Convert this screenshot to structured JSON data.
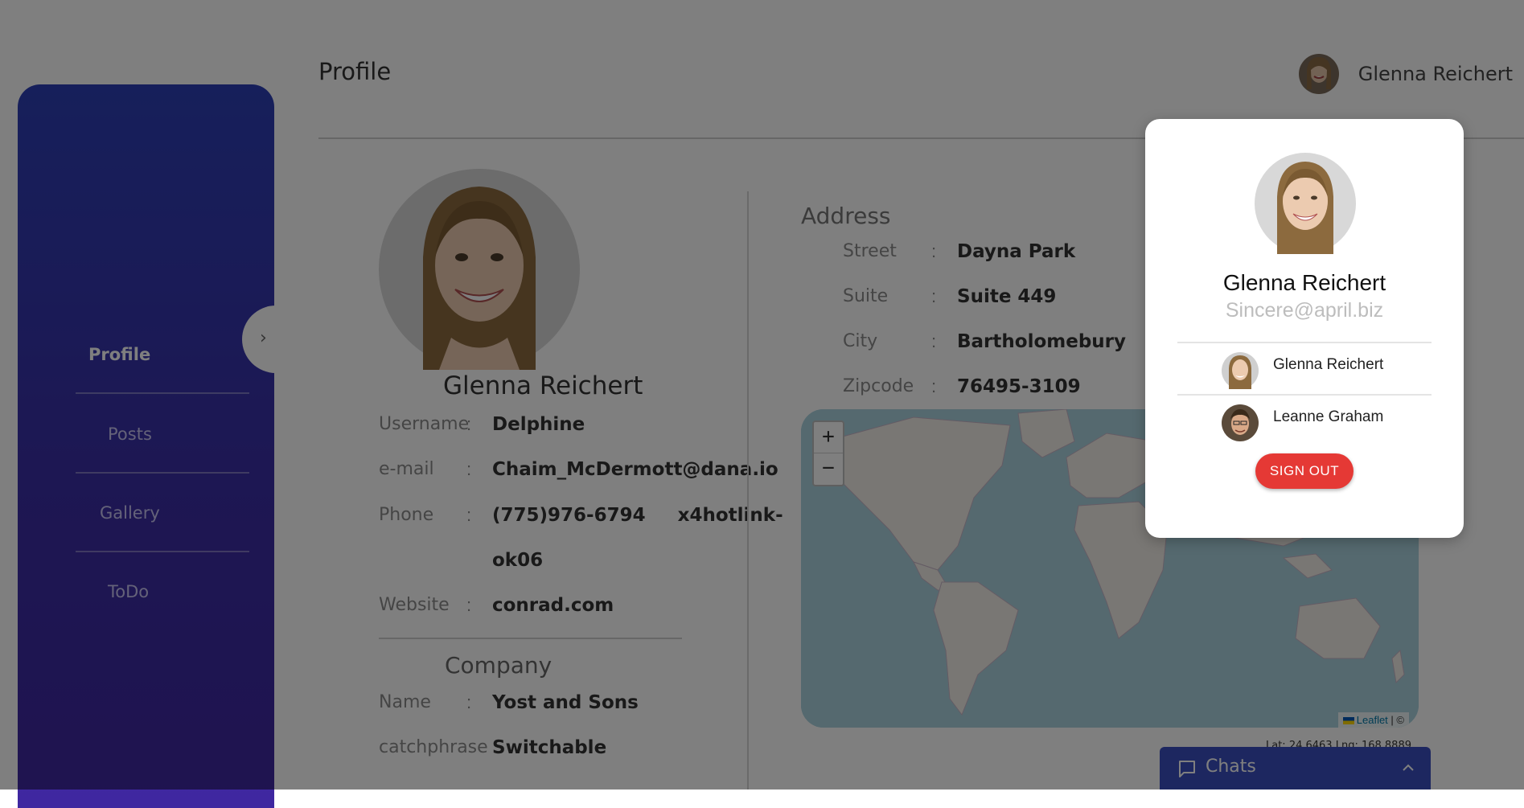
{
  "sidebar": {
    "items": [
      {
        "label": "Profile",
        "active": true
      },
      {
        "label": "Posts",
        "active": false
      },
      {
        "label": "Gallery",
        "active": false
      },
      {
        "label": "ToDo",
        "active": false
      }
    ],
    "toggle_icon": "chevron-right-icon",
    "gradient": [
      "#2d3fb6",
      "#3f27a0"
    ]
  },
  "header": {
    "title": "Profile",
    "user_name": "Glenna Reichert"
  },
  "profile": {
    "name": "Glenna Reichert",
    "fields": [
      {
        "label": "Username",
        "value": "Delphine"
      },
      {
        "label": "e-mail",
        "value": "Chaim_McDermott@dana.io"
      },
      {
        "label": "Phone",
        "value_line1": "(775)976-6794     x4hotlink-",
        "value_line2": "ok06"
      },
      {
        "label": "Website",
        "value": "conrad.com"
      }
    ],
    "company_title": "Company",
    "company_fields": [
      {
        "label": "Name",
        "value": "Yost and Sons"
      },
      {
        "label": "catchphrase",
        "value": "Switchable"
      }
    ]
  },
  "address": {
    "title": "Address",
    "fields": [
      {
        "label": "Street",
        "value": "Dayna Park"
      },
      {
        "label": "Suite",
        "value": "Suite 449"
      },
      {
        "label": "City",
        "value": "Bartholomebury"
      },
      {
        "label": "Zipcode",
        "value": "76495-3109"
      }
    ]
  },
  "map": {
    "zoom_in": "+",
    "zoom_out": "−",
    "attribution_link": "Leaflet",
    "attribution_rest": " | ©",
    "coords_text": "Lat: 24.6463   Lng: 168.8889"
  },
  "chats": {
    "label": "Chats",
    "bar_color": "#3a4fc1"
  },
  "popup": {
    "name": "Glenna Reichert",
    "email": "Sincere@april.biz",
    "accounts": [
      {
        "name": "Glenna Reichert"
      },
      {
        "name": "Leanne Graham"
      }
    ],
    "signout_label": "SIGN OUT",
    "signout_color": "#e53935"
  }
}
